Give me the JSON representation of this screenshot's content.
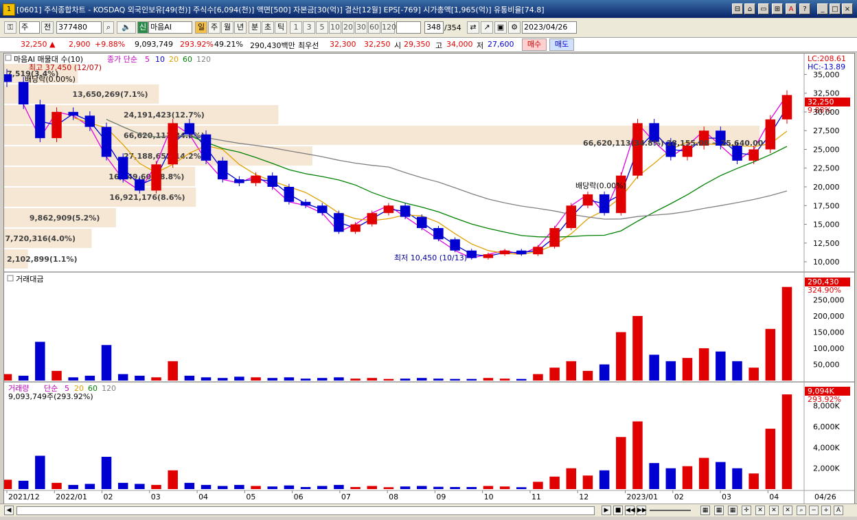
{
  "window": {
    "title": "[0601] 주식종합차트 - KOSDAQ 외국인보유[49(천)] 주식수[6,094(천)] 액면[500] 자본금[30(억)] 결산[12월] EPS[-769] 시가총액[1,965(억)] 유통비율[74.8]",
    "app_icon": "1",
    "buttons": [
      "⊟",
      "⌂",
      "▭",
      "⊞",
      "A",
      "?",
      "_",
      "□",
      "×"
    ]
  },
  "toolbar": {
    "market": "주",
    "all_label": "전",
    "code": "377480",
    "stock_name": "마음AI",
    "new_label": "신",
    "periods": [
      "일",
      "주",
      "월",
      "년",
      "분",
      "초",
      "틱"
    ],
    "active_period": "일",
    "intervals": [
      "1",
      "3",
      "5",
      "10",
      "20",
      "30",
      "60",
      "120"
    ],
    "count": "348",
    "total": "/354",
    "date": "2023/04/26"
  },
  "quote": {
    "price": "32,250",
    "arrow": "▲",
    "change": "2,900",
    "change_pct": "+9.88%",
    "volume": "9,093,749",
    "vol_ratio": "293.92%",
    "turnover": "49.21%",
    "amount": "290,430백만",
    "best_label": "최우선",
    "ask": "32,300",
    "bid": "32,250",
    "open_label": "시",
    "open": "29,350",
    "high_label": "고",
    "high": "34,000",
    "low_label": "저",
    "low": "27,600",
    "buy_label": "매수",
    "sell_label": "매도"
  },
  "price_panel": {
    "legend_name": "마음AI 매물대 수(10)",
    "legend_ma": "종가 단순",
    "ma_periods": [
      "5",
      "10",
      "20",
      "60",
      "120"
    ],
    "ma_colors": [
      "#e000e0",
      "#0000d0",
      "#e0a000",
      "#008000",
      "#808080"
    ],
    "lc": "LC:208.61",
    "hc": "HC:-13.89",
    "last_price": "32,250",
    "last_pct": "9.88%",
    "high_note": "최고 37,450 (12/07)",
    "low_note": "최저 10,450 (10/13)",
    "div_note1": "배당락(0.00%)",
    "div_note2": "배당락(0.00%)",
    "yticks": [
      "35,000",
      "32,500",
      "30,000",
      "27,500",
      "25,000",
      "22,500",
      "20,000",
      "17,500",
      "15,000",
      "12,500",
      "10,000"
    ],
    "volume_profile": [
      {
        "label": "2,102,899(1.1%)",
        "value": 2102899
      },
      {
        "label": "7,720,316(4.0%)",
        "value": 7720316
      },
      {
        "label": "9,862,909(5.2%)",
        "value": 9862909
      },
      {
        "label": "16,921,176(8.6%)",
        "value": 16921176
      },
      {
        "label": "16,849,602(8.8%)",
        "value": 16849602
      },
      {
        "label": "27,188,652(14.2%)",
        "value": 27188652
      },
      {
        "label": "66,620,113(34.8%)",
        "value": 66620113
      },
      {
        "label": "24,191,423(12.7%)",
        "value": 24191423
      },
      {
        "label": "13,650,269(7.1%)",
        "value": 13650269
      },
      {
        "label": "7,519(3.4%)",
        "value": 6500000
      }
    ],
    "overlay_text": "66,620,113(34.8%) 28,155.00 ~ 25,640.00"
  },
  "amount_panel": {
    "title": "거래대금",
    "last": "290,430",
    "last_pct": "324.90%",
    "yticks": [
      "250,000",
      "200,000",
      "150,000",
      "100,000",
      "50,000"
    ]
  },
  "volume_panel": {
    "title": "거래량",
    "legend_ma": "단순",
    "ma_periods": [
      "5",
      "20",
      "60",
      "120"
    ],
    "value_text": "9,093,749주(293.92%)",
    "last": "9,094K",
    "last_pct": "293.92%",
    "yticks": [
      "8,000K",
      "6,000K",
      "4,000K",
      "2,000K"
    ]
  },
  "xaxis": [
    "2021/12",
    "2022/01",
    "02",
    "03",
    "04",
    "05",
    "06",
    "07",
    "08",
    "09",
    "10",
    "11",
    "12",
    "2023/01",
    "02",
    "03",
    "04"
  ],
  "xaxis_right": "04/26",
  "chart_data": {
    "type": "candlestick",
    "title": "마음AI",
    "x_range": [
      "2021/12",
      "2023/04/26"
    ],
    "ylim": [
      9000,
      36500
    ],
    "series": [
      {
        "name": "close",
        "values": [
          34000,
          31000,
          26500,
          30000,
          29500,
          28000,
          24000,
          21000,
          19500,
          23000,
          28500,
          27000,
          23500,
          21000,
          20500,
          21500,
          20000,
          18000,
          17500,
          16500,
          14000,
          15000,
          16500,
          17500,
          16000,
          14500,
          13000,
          11500,
          10500,
          11000,
          11500,
          11000,
          12000,
          14500,
          17500,
          19000,
          16500,
          21500,
          28500,
          26000,
          24000,
          25500,
          27500,
          25500,
          23500,
          25000,
          29000,
          32250
        ]
      }
    ],
    "amount_values": [
      20,
      15,
      120,
      30,
      10,
      15,
      110,
      20,
      15,
      10,
      60,
      15,
      10,
      8,
      12,
      10,
      8,
      10,
      6,
      8,
      10,
      6,
      8,
      5,
      6,
      8,
      6,
      5,
      5,
      8,
      6,
      5,
      20,
      40,
      60,
      30,
      50,
      150,
      200,
      80,
      60,
      70,
      100,
      90,
      60,
      40,
      160,
      290
    ],
    "volume_values_k": [
      900,
      800,
      3200,
      600,
      400,
      500,
      3100,
      600,
      500,
      400,
      1800,
      600,
      400,
      300,
      400,
      300,
      250,
      350,
      200,
      300,
      400,
      200,
      300,
      180,
      250,
      300,
      220,
      200,
      200,
      300,
      250,
      180,
      700,
      1200,
      2000,
      1300,
      1800,
      5000,
      6500,
      2500,
      2000,
      2200,
      3000,
      2600,
      2000,
      1500,
      5800,
      9094
    ]
  }
}
